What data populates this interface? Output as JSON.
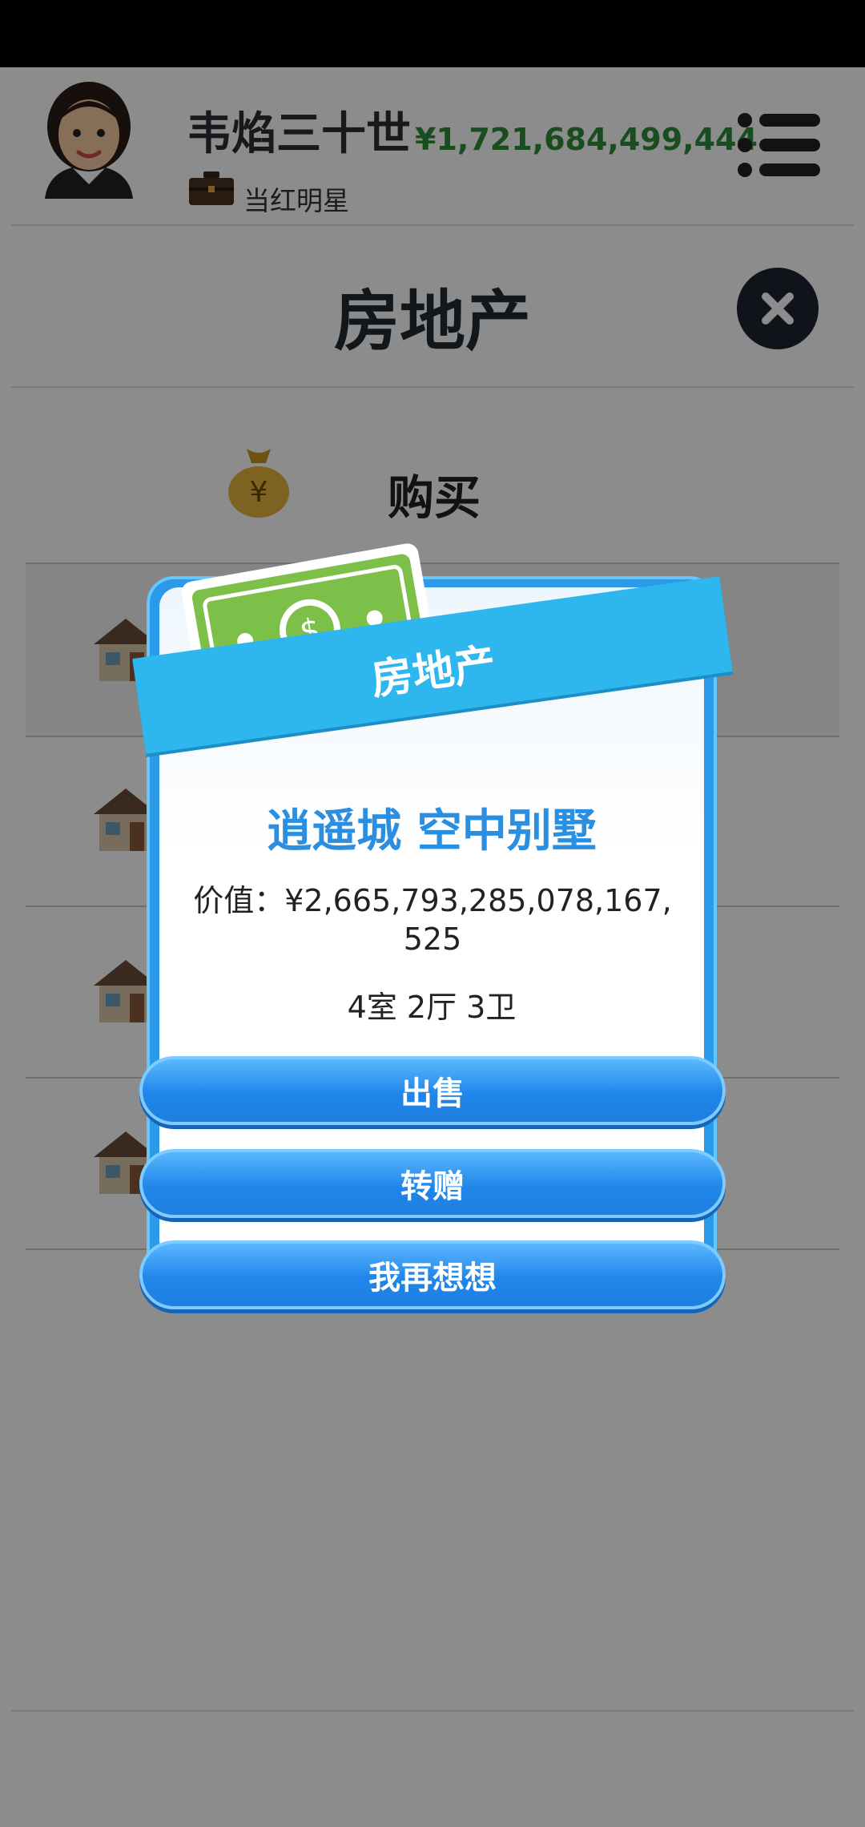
{
  "header": {
    "player_name": "韦焰三十世",
    "money": "¥1,721,684,499,444",
    "occupation": "当红明星"
  },
  "page": {
    "title": "房地产",
    "buy_label": "购买"
  },
  "dialog": {
    "banner": "房地产",
    "property_name": "逍遥城 空中别墅",
    "value_text": "价值：¥2,665,793,285,078,167,525",
    "rooms": "4室 2厅 3卫",
    "buttons": {
      "sell": "出售",
      "gift": "转赠",
      "cancel": "我再想想"
    }
  },
  "colors": {
    "accent_blue": "#2a8fe0",
    "money_green": "#2f8a3a",
    "ribbon": "#2eb6ee"
  },
  "icons": [
    "avatar",
    "briefcase-icon",
    "menu-icon",
    "close-icon",
    "money-bag-icon",
    "house-icon",
    "cash-icon"
  ]
}
